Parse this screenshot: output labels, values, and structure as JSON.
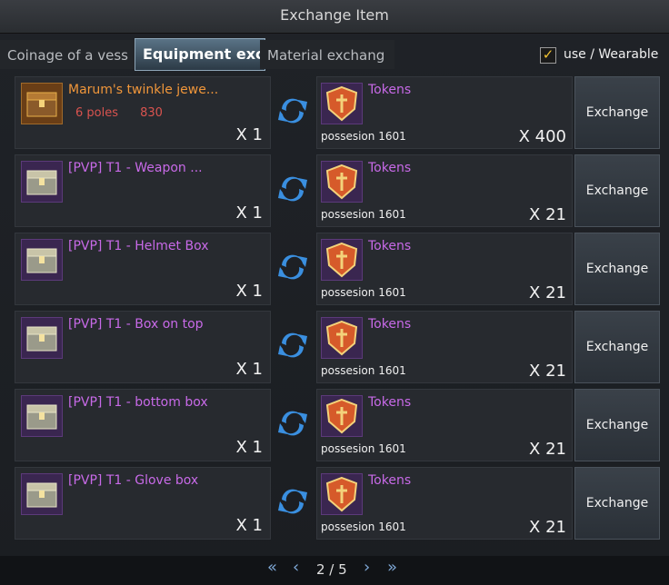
{
  "window": {
    "title": "Exchange Item"
  },
  "tabs": [
    {
      "label": "Coinage of a vess"
    },
    {
      "label": "Equipment excl"
    },
    {
      "label": "Material exchang"
    }
  ],
  "filter": {
    "checked": true,
    "label": "use / Wearable"
  },
  "rows": [
    {
      "item": {
        "name": "Marum's twinkle jewe...",
        "qty": "X 1",
        "extra_a": "6 poles",
        "extra_b": "830"
      },
      "cost": {
        "name": "Tokens",
        "possession": "possesion 1601",
        "qty": "X 400"
      },
      "button": "Exchange"
    },
    {
      "item": {
        "name": "[PVP] T1 - Weapon ...",
        "qty": "X 1"
      },
      "cost": {
        "name": "Tokens",
        "possession": "possesion 1601",
        "qty": "X 21"
      },
      "button": "Exchange"
    },
    {
      "item": {
        "name": "[PVP] T1 - Helmet Box",
        "qty": "X 1"
      },
      "cost": {
        "name": "Tokens",
        "possession": "possesion 1601",
        "qty": "X 21"
      },
      "button": "Exchange"
    },
    {
      "item": {
        "name": "[PVP] T1 - Box on top",
        "qty": "X 1"
      },
      "cost": {
        "name": "Tokens",
        "possession": "possesion 1601",
        "qty": "X 21"
      },
      "button": "Exchange"
    },
    {
      "item": {
        "name": "[PVP] T1 - bottom box",
        "qty": "X 1"
      },
      "cost": {
        "name": "Tokens",
        "possession": "possesion 1601",
        "qty": "X 21"
      },
      "button": "Exchange"
    },
    {
      "item": {
        "name": "[PVP] T1 - Glove box",
        "qty": "X 1"
      },
      "cost": {
        "name": "Tokens",
        "possession": "possesion 1601",
        "qty": "X 21"
      },
      "button": "Exchange"
    }
  ],
  "pager": {
    "text": "2 / 5",
    "first": "«",
    "prev": "‹",
    "next": "›",
    "last": "»"
  },
  "colors": {
    "rare_item": "#c86ae8",
    "legend_item": "#f0963a",
    "accent": "#7fa8d6"
  }
}
